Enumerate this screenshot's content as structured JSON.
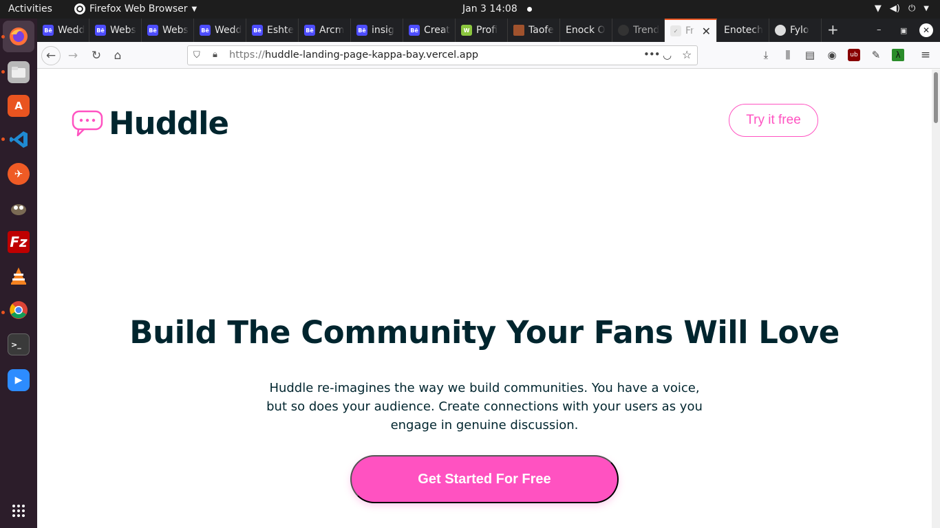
{
  "topbar": {
    "activities": "Activities",
    "app_name": "Firefox Web Browser",
    "clock": "Jan 3  14:08"
  },
  "dock": {
    "items": [
      "firefox-icon",
      "files-icon",
      "software-center-icon",
      "vscode-icon",
      "postman-icon",
      "gimp-icon",
      "filezilla-icon",
      "vlc-icon",
      "chrome-icon",
      "terminal-icon",
      "zoom-icon",
      "app-grid-icon"
    ]
  },
  "tabs": [
    {
      "label": "Wedd",
      "favicon": "Bē",
      "color": "#4d4dff"
    },
    {
      "label": "Webs",
      "favicon": "Bē",
      "color": "#4d4dff"
    },
    {
      "label": "Webs",
      "favicon": "Bē",
      "color": "#4d4dff"
    },
    {
      "label": "Wedd",
      "favicon": "Bē",
      "color": "#4d4dff"
    },
    {
      "label": "Eshte",
      "favicon": "Bē",
      "color": "#4d4dff"
    },
    {
      "label": "Arcm",
      "favicon": "Bē",
      "color": "#4d4dff"
    },
    {
      "label": "insig",
      "favicon": "Bē",
      "color": "#4d4dff"
    },
    {
      "label": "Creat",
      "favicon": "Bē",
      "color": "#4d4dff"
    },
    {
      "label": "Profi",
      "favicon": "W",
      "color": "#8cc63f"
    },
    {
      "label": "Taofe",
      "favicon": "",
      "color": "#a0522d"
    },
    {
      "label": "Enock O",
      "favicon": "",
      "color": ""
    },
    {
      "label": "Trend",
      "favicon": "",
      "color": "#333"
    },
    {
      "label": "Fr",
      "favicon": "",
      "color": "#ccc",
      "active": true
    },
    {
      "label": "Enotech",
      "favicon": "",
      "color": ""
    },
    {
      "label": "Fylo",
      "favicon": "",
      "color": "#ddd"
    }
  ],
  "navbar": {
    "url_scheme": "https://",
    "url_host": "huddle-landing-page-kappa-bay.vercel.app"
  },
  "page": {
    "logo_text": "Huddle",
    "try_button": "Try it free",
    "hero_title": "Build The Community Your Fans Will Love",
    "hero_desc": "Huddle re-imagines the way we build communities. You have a voice, but so does your audience. Create connections with your users as you engage in genuine discussion.",
    "cta_button": "Get Started For Free"
  },
  "colors": {
    "brand_pink": "#ff52c1",
    "heading": "#00252e"
  }
}
